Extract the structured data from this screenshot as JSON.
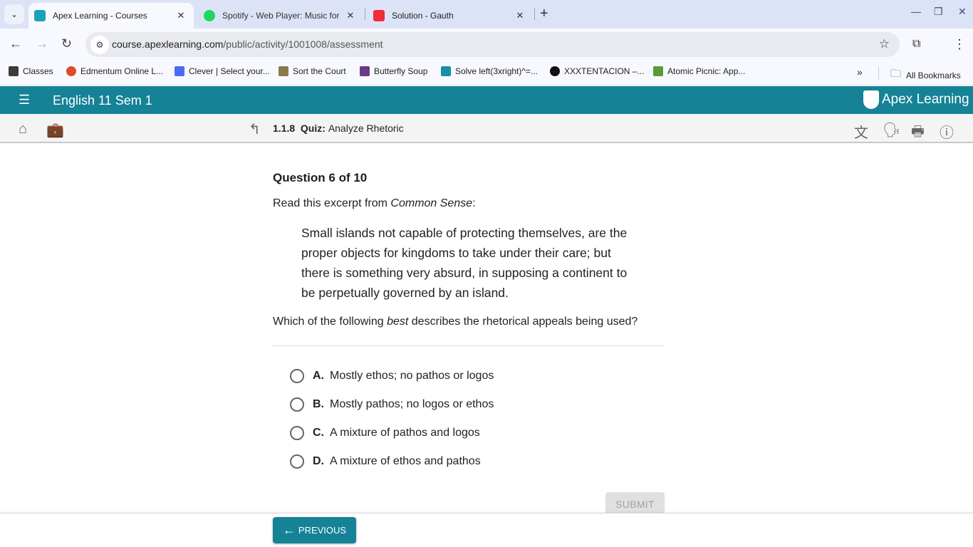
{
  "browser": {
    "tabs": [
      {
        "title": "Apex Learning - Courses",
        "active": true,
        "favicon_color": "#1aa3b8"
      },
      {
        "title": "Spotify - Web Player: Music for",
        "active": false,
        "favicon_color": "#1ed760"
      },
      {
        "title": "Solution - Gauth",
        "active": false,
        "favicon_color": "#ee2e3a"
      }
    ],
    "url_host": "course.apexlearning.com",
    "url_path": "/public/activity/1001008/assessment",
    "bookmarks": [
      {
        "label": "Classes",
        "color": "#3c3c3c"
      },
      {
        "label": "Edmentum Online L...",
        "color": "#e24a2a"
      },
      {
        "label": "Clever | Select your...",
        "color": "#4a6cf7"
      },
      {
        "label": "Sort the Court",
        "color": "#8a7a4a"
      },
      {
        "label": "Butterfly Soup",
        "color": "#6a3a8a"
      },
      {
        "label": "Solve left(3xright)^=...",
        "color": "#1a8fa8"
      },
      {
        "label": "XXXTENTACION –...",
        "color": "#111111"
      },
      {
        "label": "Atomic Picnic: App...",
        "color": "#5a9a3a"
      }
    ],
    "overflow_label": "»",
    "all_bookmarks_label": "All Bookmarks"
  },
  "app": {
    "course_title": "English 11 Sem 1",
    "logo_text": "Apex Learning",
    "brand_color": "#158296",
    "breadcrumb": {
      "number": "1.1.8",
      "type": "Quiz:",
      "name": "Analyze Rhetoric"
    }
  },
  "question": {
    "number_label": "Question 6 of 10",
    "lead_text": "Read this excerpt from ",
    "lead_source": "Common Sense",
    "lead_suffix": ":",
    "excerpt": "Small islands not capable of protecting themselves, are the proper objects for kingdoms to take under their care; but there is something very absurd, in supposing a continent to be perpetually governed by an island.",
    "prompt_before": "Which of the following ",
    "prompt_emphasis": "best",
    "prompt_after": " describes the rhetorical appeals being used?",
    "choices": [
      {
        "letter": "A.",
        "text": "Mostly ethos; no pathos or logos",
        "selected": false
      },
      {
        "letter": "B.",
        "text": "Mostly pathos; no logos or ethos",
        "selected": false
      },
      {
        "letter": "C.",
        "text": "A mixture of pathos and logos",
        "selected": false
      },
      {
        "letter": "D.",
        "text": "A mixture of ethos and pathos",
        "selected": false
      }
    ],
    "submit_label": "SUBMIT",
    "previous_label": "PREVIOUS"
  }
}
